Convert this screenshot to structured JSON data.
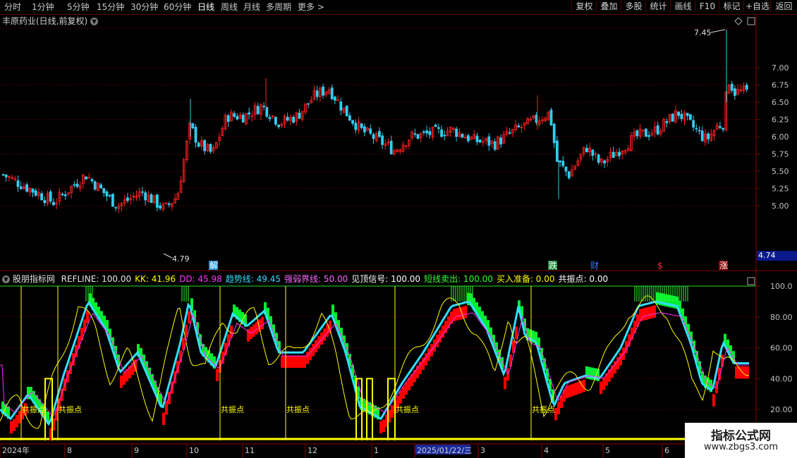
{
  "toolbar": {
    "timeframes": [
      "分时",
      "1分钟",
      "5分钟",
      "15分钟",
      "30分钟",
      "60分钟",
      "日线",
      "周线",
      "月线",
      "多周期",
      "更多 >"
    ],
    "active_timeframe": "日线",
    "right_buttons": [
      "复权",
      "叠加",
      "多股",
      "统计",
      "画线",
      "F10",
      "标记",
      "+自选",
      "返回"
    ]
  },
  "chart_header": {
    "symbol_title": "丰原药业(日线,前复权)"
  },
  "price_panel": {
    "y_ticks": [
      "7.00",
      "6.75",
      "6.50",
      "6.25",
      "6.00",
      "5.75",
      "5.50",
      "5.25",
      "5.00"
    ],
    "high_label": "7.45",
    "low_label": "4.79",
    "current_price": "4.74",
    "event_marks": [
      "解",
      "跌",
      "财",
      "$",
      "涨"
    ]
  },
  "indicator": {
    "name": "股朋指标网",
    "items": [
      {
        "label": "REFLINE:",
        "value": "100.00",
        "color": "#e6e6e6"
      },
      {
        "label": "KK:",
        "value": "41.96",
        "color": "#ffff00"
      },
      {
        "label": "DD:",
        "value": "45.98",
        "color": "#ff33ff"
      },
      {
        "label": "趋势线:",
        "value": "49.45",
        "color": "#33ddff"
      },
      {
        "label": "强弱界线:",
        "value": "50.00",
        "color": "#ff66ff"
      },
      {
        "label": "见顶信号:",
        "value": "100.00",
        "color": "#ffffff"
      },
      {
        "label": "短线卖出:",
        "value": "100.00",
        "color": "#33ff33"
      },
      {
        "label": "买入准备:",
        "value": "0.00",
        "color": "#ffff00"
      },
      {
        "label": "共振点:",
        "value": "0.00",
        "color": "#ffffff"
      }
    ],
    "y_ticks": [
      "100.0",
      "80.00",
      "60.00",
      "40.00",
      "20.00"
    ],
    "resonance_label": "共振点"
  },
  "time_axis": {
    "labels": [
      "2024年",
      "8",
      "9",
      "10",
      "11",
      "12",
      "1",
      "2025/01/22/三",
      "3",
      "4",
      "5",
      "6"
    ]
  },
  "watermark": {
    "title": "指标公式网",
    "url": "www.zbgs3.com"
  },
  "colors": {
    "up": "#ff2020",
    "down": "#33ccee",
    "grid": "#8a0000",
    "bull": "#ff0000",
    "bear": "#00ee33",
    "trend": "#33ddff"
  }
}
